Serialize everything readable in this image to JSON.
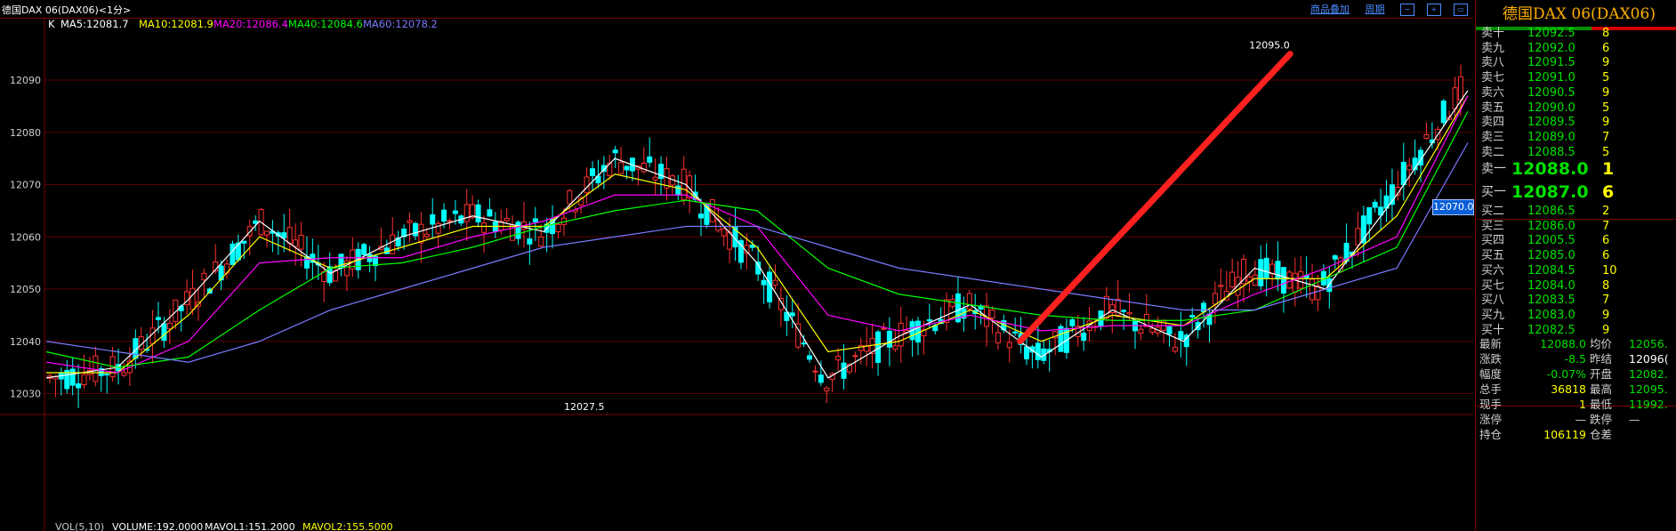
{
  "header": {
    "title": "德国DAX 06(DAX06)<1分>",
    "link_overlay": "商品叠加",
    "link_period": "周期"
  },
  "ma_legend": {
    "k": "K",
    "ma5": "MA5:12081.7",
    "ma10": "MA10:12081.9",
    "ma20": "MA20:12086.4",
    "ma40": "MA40:12084.6",
    "ma60": "MA60:12078.2"
  },
  "volume_legend": {
    "vol": "VOL(5,10)",
    "volume": "VOLUME:192.0000",
    "mavol1": "MAVOL1:151.2000",
    "mavol2": "MAVOL2:155.5000"
  },
  "chart_data": {
    "type": "line",
    "ylim": [
      12026,
      12098
    ],
    "y_ticks": [
      "12090",
      "12080",
      "12070",
      "12060",
      "12050",
      "12040",
      "12030"
    ],
    "y_tick_values": [
      12090,
      12080,
      12070,
      12060,
      12050,
      12040,
      12030
    ],
    "x": [
      0,
      10,
      20,
      30,
      40,
      50,
      60,
      70,
      80,
      90,
      100,
      110,
      120,
      130,
      140,
      150,
      160,
      170,
      180,
      190,
      200
    ],
    "series": [
      {
        "name": "MA5",
        "color": "#ffffff",
        "values": [
          12033,
          12035,
          12048,
          12063,
          12053,
          12060,
          12064,
          12061,
          12075,
          12070,
          12055,
          12033,
          12041,
          12047,
          12037,
          12046,
          12040,
          12054,
          12050,
          12068,
          12088
        ]
      },
      {
        "name": "MA10",
        "color": "#ffff00",
        "values": [
          12034,
          12034,
          12045,
          12060,
          12054,
          12058,
          12062,
          12062,
          12072,
          12069,
          12058,
          12038,
          12040,
          12046,
          12040,
          12045,
          12043,
          12052,
          12052,
          12064,
          12087
        ]
      },
      {
        "name": "MA20",
        "color": "#ff00ff",
        "values": [
          12036,
          12034,
          12040,
          12055,
          12056,
          12056,
          12060,
          12063,
          12068,
          12068,
          12062,
          12045,
          12042,
          12045,
          12042,
          12043,
          12043,
          12049,
          12054,
          12060,
          12087
        ]
      },
      {
        "name": "MA40",
        "color": "#00ff00",
        "values": [
          12038,
          12035,
          12037,
          12046,
          12054,
          12055,
          12058,
          12062,
          12065,
          12067,
          12065,
          12054,
          12049,
          12047,
          12045,
          12044,
          12044,
          12046,
          12052,
          12058,
          12084
        ]
      },
      {
        "name": "MA60",
        "color": "#7a7aff",
        "values": [
          12040,
          12038,
          12036,
          12040,
          12046,
          12050,
          12054,
          12058,
          12060,
          12062,
          12062,
          12058,
          12054,
          12052,
          12050,
          12048,
          12046,
          12046,
          12050,
          12054,
          12078
        ]
      }
    ],
    "annotations": [
      "12095.0",
      "12027.5"
    ],
    "trend_line": {
      "from": {
        "x": 137,
        "y": 12040
      },
      "to": {
        "x": 175,
        "y": 12095
      },
      "color": "#ff2020"
    },
    "current_price_tag": "12070.0"
  },
  "orderbook": {
    "stock_name": "德国DAX  06(DAX06)",
    "asks": [
      {
        "label": "卖十",
        "price": "12092.5",
        "vol": "8"
      },
      {
        "label": "卖九",
        "price": "12092.0",
        "vol": "6"
      },
      {
        "label": "卖八",
        "price": "12091.5",
        "vol": "9"
      },
      {
        "label": "卖七",
        "price": "12091.0",
        "vol": "5"
      },
      {
        "label": "卖六",
        "price": "12090.5",
        "vol": "9"
      },
      {
        "label": "卖五",
        "price": "12090.0",
        "vol": "5"
      },
      {
        "label": "卖四",
        "price": "12089.5",
        "vol": "9"
      },
      {
        "label": "卖三",
        "price": "12089.0",
        "vol": "7"
      },
      {
        "label": "卖二",
        "price": "12088.5",
        "vol": "5"
      },
      {
        "label": "卖一",
        "price": "12088.0",
        "vol": "1"
      }
    ],
    "bids": [
      {
        "label": "买一",
        "price": "12087.0",
        "vol": "6"
      },
      {
        "label": "买二",
        "price": "12086.5",
        "vol": "2"
      },
      {
        "label": "买三",
        "price": "12086.0",
        "vol": "7"
      },
      {
        "label": "买四",
        "price": "12005.5",
        "vol": "6"
      },
      {
        "label": "买五",
        "price": "12085.0",
        "vol": "6"
      },
      {
        "label": "买六",
        "price": "12084.5",
        "vol": "10"
      },
      {
        "label": "买七",
        "price": "12084.0",
        "vol": "8"
      },
      {
        "label": "买八",
        "price": "12083.5",
        "vol": "7"
      },
      {
        "label": "买九",
        "price": "12083.0",
        "vol": "9"
      },
      {
        "label": "买十",
        "price": "12082.5",
        "vol": "9"
      }
    ]
  },
  "quote": [
    {
      "l1": "最新",
      "v1": "12088.0",
      "c1": "#00e000",
      "l2": "均价",
      "v2": "12056.",
      "c2": "#00e000"
    },
    {
      "l1": "涨跌",
      "v1": "-8.5",
      "c1": "#00e000",
      "l2": "昨结",
      "v2": "12096(",
      "c2": "#ffffff"
    },
    {
      "l1": "幅度",
      "v1": "-0.07%",
      "c1": "#00e000",
      "l2": "开盘",
      "v2": "12082.",
      "c2": "#00e000"
    },
    {
      "l1": "总手",
      "v1": "36818",
      "c1": "#ffff00",
      "l2": "最高",
      "v2": "12095.",
      "c2": "#00e000"
    },
    {
      "l1": "现手",
      "v1": "1",
      "c1": "#ffff00",
      "l2": "最低",
      "v2": "11992.",
      "c2": "#00e000"
    },
    {
      "l1": "涨停",
      "v1": "—",
      "c1": "#d0d0d0",
      "l2": "跌停",
      "v2": "—",
      "c2": "#d0d0d0"
    },
    {
      "l1": "持仓",
      "v1": "106119",
      "c1": "#ffff00",
      "l2": "仓差",
      "v2": "",
      "c2": "#d0d0d0"
    }
  ]
}
